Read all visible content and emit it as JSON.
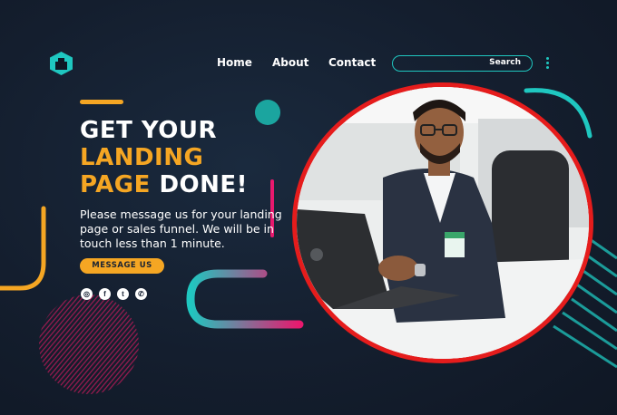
{
  "nav": {
    "links": [
      "Home",
      "About",
      "Contact"
    ],
    "search_placeholder": "Search"
  },
  "hero": {
    "line1": "GET YOUR",
    "line2": "LANDING",
    "line3_part1": "PAGE",
    "line3_part2": "DONE!",
    "tagline": "Please message us for your landing page or sales funnel. We will be in touch less than 1 minute.",
    "cta_label": "MESSAGE US"
  },
  "social": {
    "icons": [
      "instagram-icon",
      "facebook-icon",
      "twitter-icon",
      "whatsapp-icon"
    ],
    "glyphs": [
      "◎",
      "f",
      "t",
      "✆"
    ]
  },
  "colors": {
    "background": "#141e2e",
    "accent": "#f5a623",
    "teal": "#1fc7c0",
    "pink": "#e8196e",
    "photo_border": "#e51c1c"
  }
}
